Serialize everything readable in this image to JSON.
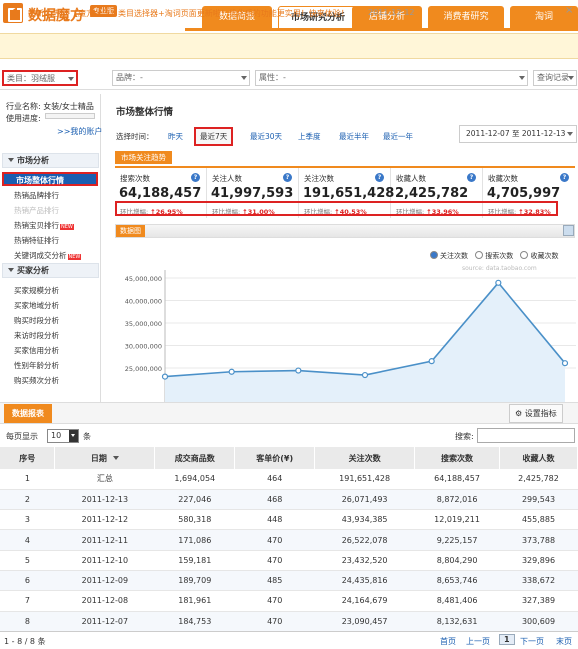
{
  "app": {
    "logo_text": "数据魔方",
    "badge": "专业版"
  },
  "nav": {
    "tabs": [
      "数据简报",
      "市场研究分析",
      "店铺分析",
      "消费者研究",
      "淘词"
    ],
    "active": 1
  },
  "notice": {
    "label": "最新公告:",
    "text": "【魔方公告】类目选择器+淘词页面更新啦！优化后的功能更实用！快来体验！",
    "date": "2011-12-12"
  },
  "filters": {
    "category": "类目：羽绒服",
    "brand": "品牌：-",
    "attribute": "属性：-",
    "query": "查询记录"
  },
  "sidebar": {
    "industry_line": "行业名称: 女装/女士精品",
    "progress_label": "使用进度:",
    "my_account": ">>我的账户",
    "section_market": "市场分析",
    "market_items": [
      {
        "label": "市场整体行情",
        "active": true,
        "dim": false,
        "badge": ""
      },
      {
        "label": "热销品牌排行",
        "active": false,
        "dim": false,
        "badge": ""
      },
      {
        "label": "热销产品排行",
        "active": false,
        "dim": true,
        "badge": ""
      },
      {
        "label": "热销宝贝排行",
        "active": false,
        "dim": false,
        "badge": "NEW"
      },
      {
        "label": "热销特征排行",
        "active": false,
        "dim": false,
        "badge": ""
      },
      {
        "label": "关键词成交分析",
        "active": false,
        "dim": false,
        "badge": "NEW"
      }
    ],
    "section_buyer": "买家分析",
    "buyer_items": [
      "买家规模分析",
      "买家地域分析",
      "购买时段分析",
      "来访时段分析",
      "买家信用分析",
      "性别年龄分析",
      "购买频次分析"
    ]
  },
  "main": {
    "title": "市场整体行情",
    "time_label": "选择时间：",
    "time_options": [
      "昨天",
      "最近7天",
      "最近30天",
      "上季度",
      "最近半年",
      "最近一年"
    ],
    "date_range": "2011-12-07 至 2011-12-13",
    "attention_tab": "市场关注趋势",
    "stats": [
      {
        "label": "搜索次数",
        "value": "64,188,457",
        "change": "↑26.95%"
      },
      {
        "label": "关注人数",
        "value": "41,997,593",
        "change": "↑31.00%"
      },
      {
        "label": "关注次数",
        "value": "191,651,428",
        "change": "↑40.53%"
      },
      {
        "label": "收藏人数",
        "value": "2,425,782",
        "change": "↑33.96%"
      },
      {
        "label": "收藏次数",
        "value": "4,705,997",
        "change": "↑32.83%"
      }
    ],
    "change_label": "环比增幅:",
    "help_glyph": "?"
  },
  "chart": {
    "tab": "数据图",
    "watermark": "source: data.taobao.com",
    "legend": [
      "关注次数",
      "搜索次数",
      "收藏次数"
    ],
    "legend_active": 0
  },
  "chart_data": {
    "type": "line",
    "x": [
      "2011-12-07",
      "2011-12-08",
      "2011-12-09",
      "2011-12-10",
      "2011-12-11",
      "2011-12-12",
      "2011-12-13"
    ],
    "series": [
      {
        "name": "关注次数",
        "values": [
          23090457,
          24164679,
          24435816,
          23432520,
          26522078,
          43934385,
          26071493
        ]
      }
    ],
    "yticks": [
      "45,000,000",
      "40,000,000",
      "35,000,000",
      "30,000,000",
      "25,000,000"
    ],
    "ylim": [
      20000000,
      45000000
    ],
    "color": "#4a90c8"
  },
  "report": {
    "tab": "数据报表",
    "settings": "设置指标",
    "per_page_label": "每页显示",
    "per_page_value": "10",
    "per_page_unit": "条",
    "search_label": "搜索:",
    "columns": [
      "序号",
      "日期",
      "成交商品数",
      "客单价(¥)",
      "关注次数",
      "搜索次数",
      "收藏人数"
    ],
    "rows": [
      [
        "1",
        "汇总",
        "1,694,054",
        "464",
        "191,651,428",
        "64,188,457",
        "2,425,782"
      ],
      [
        "2",
        "2011-12-13",
        "227,046",
        "468",
        "26,071,493",
        "8,872,016",
        "299,543"
      ],
      [
        "3",
        "2011-12-12",
        "580,318",
        "448",
        "43,934,385",
        "12,019,211",
        "455,885"
      ],
      [
        "4",
        "2011-12-11",
        "171,086",
        "470",
        "26,522,078",
        "9,225,157",
        "373,788"
      ],
      [
        "5",
        "2011-12-10",
        "159,181",
        "470",
        "23,432,520",
        "8,804,290",
        "329,896"
      ],
      [
        "6",
        "2011-12-09",
        "189,709",
        "485",
        "24,435,816",
        "8,653,746",
        "338,672"
      ],
      [
        "7",
        "2011-12-08",
        "181,961",
        "470",
        "24,164,679",
        "8,481,406",
        "327,389"
      ],
      [
        "8",
        "2011-12-07",
        "184,753",
        "470",
        "23,090,457",
        "8,132,631",
        "300,609"
      ]
    ],
    "footer_count": "1 - 8 / 8 条",
    "pager": [
      "首页",
      "上一页",
      "1",
      "下一页",
      "末页"
    ]
  }
}
